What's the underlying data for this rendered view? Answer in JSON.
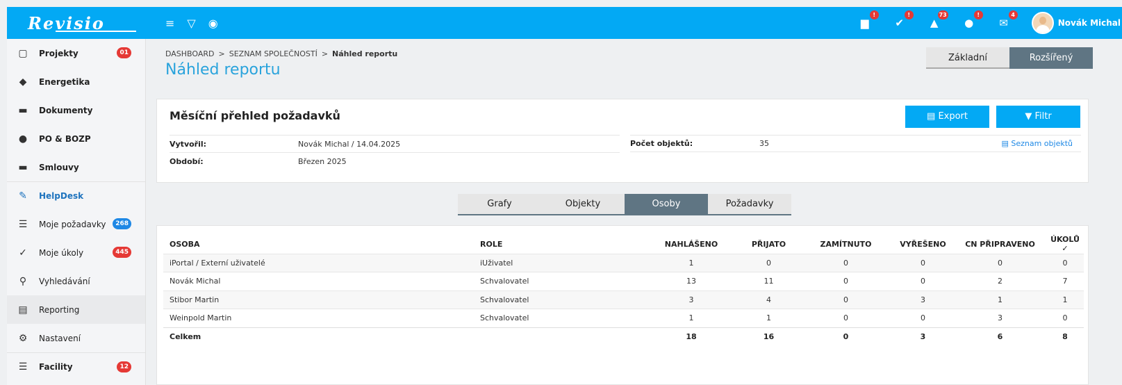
{
  "app": {
    "logo": "Revisio"
  },
  "topbar": {
    "tools": [
      {
        "icon": "menu-icon",
        "glyph": "≡"
      },
      {
        "icon": "filter-icon",
        "glyph": "▽"
      },
      {
        "icon": "toggle-icon",
        "glyph": "◉"
      }
    ],
    "notifications": [
      {
        "icon": "gift-icon",
        "glyph": "▆",
        "badge": "!"
      },
      {
        "icon": "check-icon",
        "glyph": "✔",
        "badge": "!"
      },
      {
        "icon": "bell-icon",
        "glyph": "▲",
        "badge": "73"
      },
      {
        "icon": "chat-icon",
        "glyph": "●",
        "badge": "!"
      },
      {
        "icon": "mail-icon",
        "glyph": "✉",
        "badge": "4"
      }
    ],
    "user_name": "Novák Michal"
  },
  "sidebar": {
    "items": [
      {
        "label": "Projekty",
        "icon": "calendar-icon",
        "glyph": "▢",
        "badge": "01",
        "badge_color": "red"
      },
      {
        "label": "Energetika",
        "icon": "tag-icon",
        "glyph": "◆"
      },
      {
        "label": "Dokumenty",
        "icon": "archive-icon",
        "glyph": "▬"
      },
      {
        "label": "PO & BOZP",
        "icon": "fire-icon",
        "glyph": "●"
      },
      {
        "label": "Smlouvy",
        "icon": "folder-icon",
        "glyph": "▬"
      },
      {
        "label": "HelpDesk",
        "icon": "wrench-icon",
        "glyph": "✎"
      },
      {
        "label": "Moje požadavky",
        "icon": "list-icon",
        "glyph": "☰",
        "badge": "268",
        "badge_color": "blue"
      },
      {
        "label": "Moje úkoly",
        "icon": "check-icon",
        "glyph": "✓",
        "badge": "445",
        "badge_color": "red"
      },
      {
        "label": "Vyhledávání",
        "icon": "search-icon",
        "glyph": "⚲"
      },
      {
        "label": "Reporting",
        "icon": "report-icon",
        "glyph": "▤"
      },
      {
        "label": "Nastavení",
        "icon": "cogs-icon",
        "glyph": "⚙"
      },
      {
        "label": "Facility",
        "icon": "list-icon",
        "glyph": "☰",
        "badge": "12",
        "badge_color": "red"
      }
    ]
  },
  "breadcrumb": {
    "items": [
      "DASHBOARD",
      "SEZNAM SPOLEČNOSTÍ"
    ],
    "current": "Náhled reportu",
    "separator": ">"
  },
  "page_title": "Náhled reportu",
  "view_toggle": {
    "basic": "Základní",
    "advanced": "Rozšířený"
  },
  "report": {
    "title": "Měsíční přehled požadavků",
    "export_label": "Export",
    "filter_label": "Filtr",
    "created_by_label": "Vytvořil:",
    "created_by_value": "Novák Michal / 14.04.2025",
    "period_label": "Období:",
    "period_value": "Březen 2025",
    "objects_count_label": "Počet objektů:",
    "objects_count_value": "35",
    "objects_list_link": "Seznam objektů"
  },
  "tabs": [
    {
      "label": "Grafy"
    },
    {
      "label": "Objekty"
    },
    {
      "label": "Osoby"
    },
    {
      "label": "Požadavky"
    }
  ],
  "table": {
    "headers": [
      "OSOBA",
      "ROLE",
      "NAHLÁŠENO",
      "PŘIJATO",
      "ZAMÍTNUTO",
      "VYŘEŠENO",
      "CN PŘIPRAVENO",
      "ÚKOLŮ ✓"
    ],
    "rows": [
      [
        "iPortal / Externí uživatelé",
        "iUživatel",
        "1",
        "0",
        "0",
        "0",
        "0",
        "0"
      ],
      [
        "Novák Michal",
        "Schvalovatel",
        "13",
        "11",
        "0",
        "0",
        "2",
        "7"
      ],
      [
        "Stibor Martin",
        "Schvalovatel",
        "3",
        "4",
        "0",
        "3",
        "1",
        "1"
      ],
      [
        "Weinpold Martin",
        "Schvalovatel",
        "1",
        "1",
        "0",
        "0",
        "3",
        "0"
      ]
    ],
    "total": [
      "Celkem",
      "",
      "18",
      "16",
      "0",
      "3",
      "6",
      "8"
    ]
  },
  "colors": {
    "accent": "#03a9f4",
    "title_blue": "#29a3dc",
    "toggle_active": "#5f7583",
    "badge_red": "#e53935",
    "badge_blue": "#1e88e5"
  }
}
